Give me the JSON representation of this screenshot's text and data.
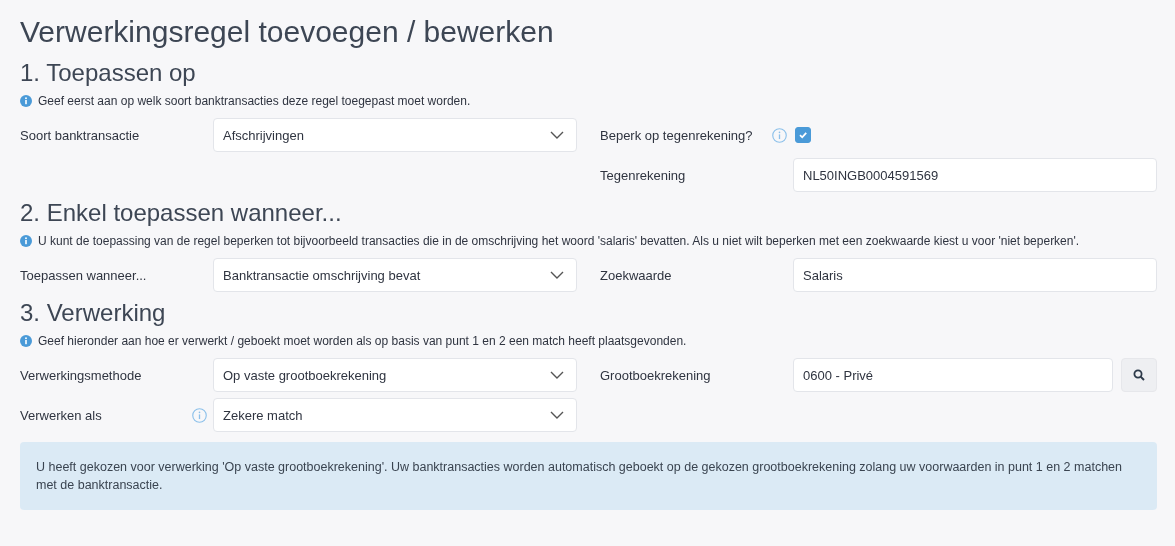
{
  "title": "Verwerkingsregel toevoegen / bewerken",
  "sections": [
    {
      "heading": "1. Toepassen op",
      "info": "Geef eerst aan op welk soort banktransacties deze regel toegepast moet worden.",
      "rows": [
        {
          "left": {
            "kind": "select",
            "label": "Soort banktransactie",
            "value": "Afschrijvingen"
          },
          "right": {
            "kind": "checkbox",
            "label": "Beperk op tegenrekening?",
            "help": true,
            "checked": true
          }
        },
        {
          "right": {
            "kind": "text",
            "label": "Tegenrekening",
            "value": "NL50INGB0004591569"
          }
        }
      ]
    },
    {
      "heading": "2. Enkel toepassen wanneer...",
      "info": "U kunt de toepassing van de regel beperken tot bijvoorbeeld transacties die in de omschrijving het woord 'salaris' bevatten. Als u niet wilt beperken met een zoekwaarde kiest u voor 'niet beperken'.",
      "rows": [
        {
          "left": {
            "kind": "select",
            "label": "Toepassen wanneer...",
            "value": "Banktransactie omschrijving bevat"
          },
          "right": {
            "kind": "text",
            "label": "Zoekwaarde",
            "value": "Salaris"
          }
        }
      ]
    },
    {
      "heading": "3. Verwerking",
      "info": "Geef hieronder aan hoe er verwerkt / geboekt moet worden als op basis van punt 1 en 2 een match heeft plaatsgevonden.",
      "rows": [
        {
          "left": {
            "kind": "select",
            "label": "Verwerkingsmethode",
            "value": "Op vaste grootboekrekening"
          },
          "right": {
            "kind": "lookup",
            "label": "Grootboekrekening",
            "value": "0600 - Privé"
          }
        },
        {
          "left": {
            "kind": "select",
            "label": "Verwerken als",
            "help": true,
            "value": "Zekere match"
          }
        }
      ],
      "note": "U heeft gekozen voor verwerking 'Op vaste grootboekrekening'. Uw banktransacties worden automatisch geboekt op de gekozen grootboekrekening zolang uw voorwaarden in punt 1 en 2 matchen met de banktransactie."
    }
  ]
}
